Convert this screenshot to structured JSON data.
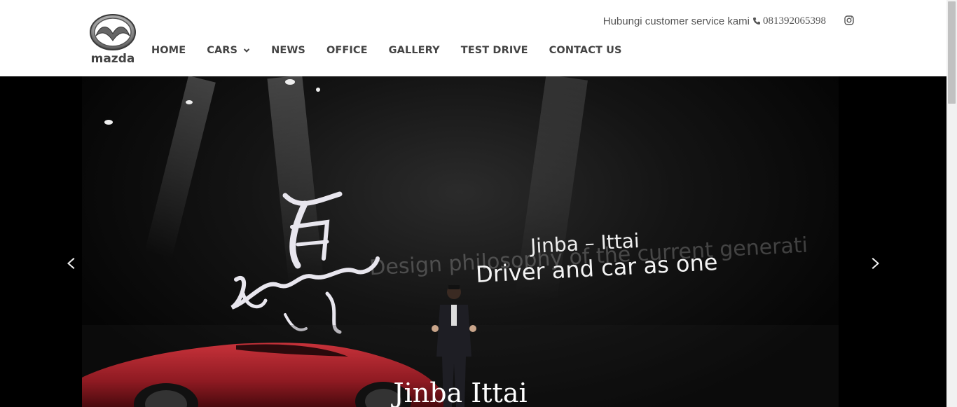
{
  "brand": {
    "logo_alt": "mazda",
    "logo_text": "mazda"
  },
  "topbar": {
    "label": "Hubungi customer service kami",
    "phone": "081392065398",
    "phone_icon": "phone-icon",
    "social_icon": "instagram-icon"
  },
  "nav": {
    "items": [
      {
        "label": "HOME"
      },
      {
        "label": "CARS",
        "has_dropdown": true
      },
      {
        "label": "NEWS"
      },
      {
        "label": "OFFICE"
      },
      {
        "label": "GALLERY"
      },
      {
        "label": "TEST DRIVE"
      },
      {
        "label": "CONTACT US"
      }
    ]
  },
  "hero": {
    "screen_line1": "Jinba – Ittai",
    "screen_line2": "Driver and car as one",
    "screen_ghost": "Design philosophy of the current generati",
    "calligraphy": "Jinba-ittai",
    "caption": "Jinba Ittai",
    "prev_icon": "chevron-left-icon",
    "next_icon": "chevron-right-icon"
  },
  "colors": {
    "nav_text": "#444444",
    "topbar_text": "#555555",
    "hero_bg": "#000000",
    "car_red": "#9b1b22"
  }
}
